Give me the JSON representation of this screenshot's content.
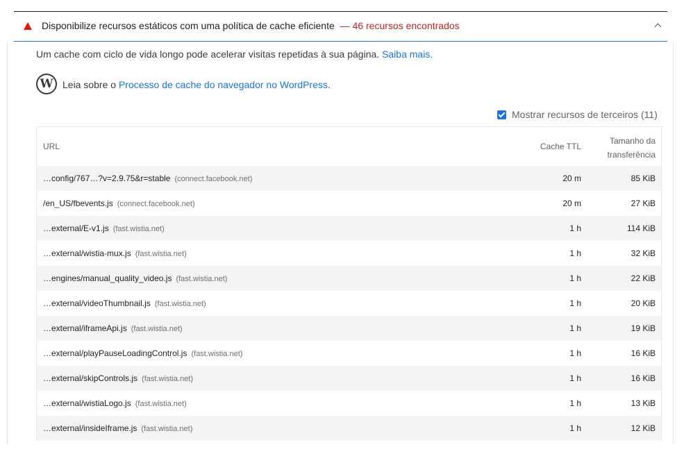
{
  "audit": {
    "title": "Disponibilize recursos estáticos com uma política de cache eficiente",
    "display_value": "— 46 recursos encontrados",
    "status_color": "#e8140f",
    "description": "Um cache com ciclo de vida longo pode acelerar visitas repetidas à sua página.",
    "learn_more": "Saiba mais.",
    "stack_pack_prefix": "Leia sobre o",
    "stack_pack_link": "Processo de cache do navegador no WordPress.",
    "stack_pack_icon": "wordpress-icon",
    "third_party_toggle": "Mostrar recursos de terceiros (11)",
    "third_party_checked": true
  },
  "table": {
    "headers": {
      "url": "URL",
      "cache_ttl": "Cache TTL",
      "transfer_size_1": "Tamanho da",
      "transfer_size_2": "transferência"
    },
    "rows": [
      {
        "url": "…config/767…?v=2.9.75&r=stable",
        "host": "(connect.facebook.net)",
        "ttl": "20 m",
        "size": "85 KiB"
      },
      {
        "url": "/en_US/fbevents.js",
        "host": "(connect.facebook.net)",
        "ttl": "20 m",
        "size": "27 KiB"
      },
      {
        "url": "…external/E-v1.js",
        "host": "(fast.wistia.net)",
        "ttl": "1 h",
        "size": "114 KiB"
      },
      {
        "url": "…external/wistia-mux.js",
        "host": "(fast.wistia.net)",
        "ttl": "1 h",
        "size": "32 KiB"
      },
      {
        "url": "…engines/manual_quality_video.js",
        "host": "(fast.wistia.net)",
        "ttl": "1 h",
        "size": "22 KiB"
      },
      {
        "url": "…external/videoThumbnail.js",
        "host": "(fast.wistia.net)",
        "ttl": "1 h",
        "size": "20 KiB"
      },
      {
        "url": "…external/iframeApi.js",
        "host": "(fast.wistia.net)",
        "ttl": "1 h",
        "size": "19 KiB"
      },
      {
        "url": "…external/playPauseLoadingControl.js",
        "host": "(fast.wistia.net)",
        "ttl": "1 h",
        "size": "16 KiB"
      },
      {
        "url": "…external/skipControls.js",
        "host": "(fast.wistia.net)",
        "ttl": "1 h",
        "size": "16 KiB"
      },
      {
        "url": "…external/wistiaLogo.js",
        "host": "(fast.wistia.net)",
        "ttl": "1 h",
        "size": "13 KiB"
      },
      {
        "url": "…external/insideIframe.js",
        "host": "(fast.wistia.net)",
        "ttl": "1 h",
        "size": "12 KiB"
      }
    ]
  }
}
